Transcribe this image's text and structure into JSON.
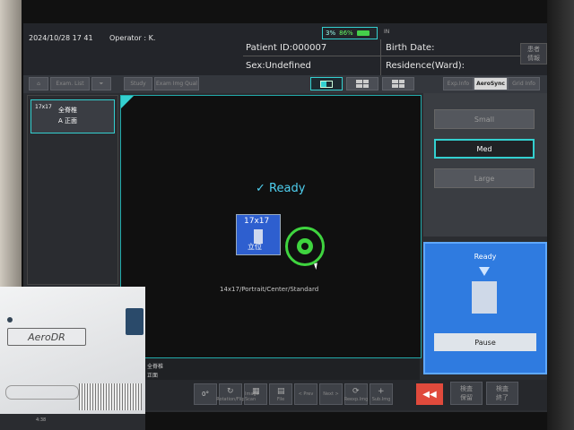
{
  "header": {
    "datetime": "2024/10/28 17 41",
    "operator": "Operator : K.",
    "patient_id": "Patient ID:000007",
    "sex": "Sex:Undefined",
    "birth_date": "Birth Date:",
    "residence": "Residence(Ward):",
    "status_percent": "86%",
    "status_small": "3%",
    "header_btn_label": "患者\n情報",
    "header_small": "IN"
  },
  "toolbar": {
    "exam_list": "Exam. List",
    "study": "Study",
    "exam_img_qual": "Exam Img Qual",
    "layout_single": "1x1",
    "layout_grid": "2x2",
    "layout_grid2": "4x"
  },
  "left_list": {
    "item_size": "17x17",
    "item_label1": "全脊椎",
    "item_label2": "A 正面"
  },
  "viewer": {
    "status": "✓ Ready",
    "plate_size": "17x17",
    "plate_kanji": "立位",
    "description": "14x17/Portrait/Center/Standard",
    "bottom_label1": "全脊椎",
    "bottom_label2": "正面"
  },
  "right_tabs": {
    "exp_info": "Exp.Info",
    "aerosync": "AeroSync",
    "grid_info": "Grid Info"
  },
  "size_buttons": {
    "small": "Small",
    "med": "Med",
    "large": "Large"
  },
  "detector": {
    "status": "Ready",
    "pause": "Pause"
  },
  "bottom_toolbar": {
    "angle": "0°",
    "b1": "Rotation/Flip",
    "b2": "Image Scan",
    "b3": "File",
    "prev": "< Prev",
    "next": "Next >",
    "b4": "Reexp.Img",
    "b5": "Sub.Img",
    "back": "◀◀",
    "end1": "検査\n保留",
    "end2": "検査\n終了"
  },
  "device": {
    "brand": "AeroDR",
    "base_text": "4:38"
  }
}
